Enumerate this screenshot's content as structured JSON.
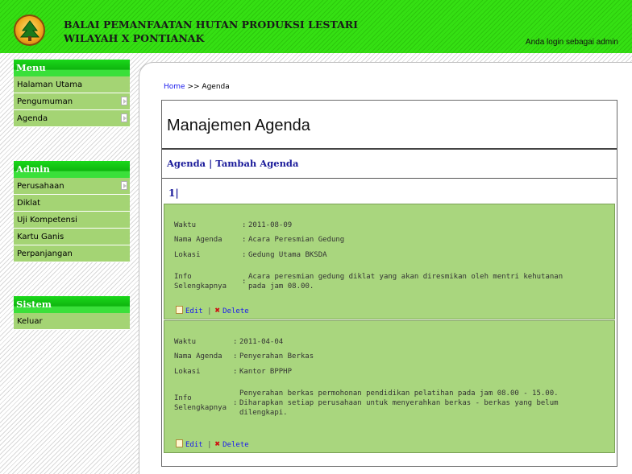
{
  "header": {
    "title_line1": "BALAI PEMANFAATAN HUTAN PRODUKSI LESTARI",
    "title_line2": "WILAYAH X PONTIANAK",
    "login_text": "Anda login sebagai admin",
    "logo_icon": "tree-logo-icon"
  },
  "sidebar": {
    "menu": {
      "title": "Menu",
      "items": [
        {
          "label": "Halaman Utama"
        },
        {
          "label": "Pengumuman"
        },
        {
          "label": "Agenda"
        }
      ]
    },
    "admin": {
      "title": "Admin",
      "items": [
        {
          "label": "Perusahaan"
        },
        {
          "label": "Diklat"
        },
        {
          "label": "Uji Kompetensi"
        },
        {
          "label": "Kartu Ganis"
        },
        {
          "label": "Perpanjangan"
        }
      ]
    },
    "sistem": {
      "title": "Sistem",
      "items": [
        {
          "label": "Keluar"
        }
      ]
    }
  },
  "main": {
    "breadcrumb": {
      "home": "Home",
      "separator": ">>",
      "current": "Agenda"
    },
    "page_title": "Manajemen Agenda",
    "subnav": {
      "agenda": "Agenda",
      "separator": "|",
      "tambah": "Tambah Agenda"
    },
    "pagination": {
      "page": "1",
      "separator": "|"
    },
    "labels": {
      "waktu": "Waktu",
      "nama": "Nama Agenda",
      "lokasi": "Lokasi",
      "info_line1": "Info",
      "info_line2": "Selengkapnya",
      "colon": ":",
      "edit": "Edit",
      "delete": "Delete",
      "action_sep": "|"
    },
    "agendas": [
      {
        "waktu": "2011-08-09",
        "nama": "Acara Peresmian Gedung",
        "lokasi": "Gedung Utama BKSDA",
        "info": [
          "Acara peresmian gedung diklat yang akan diresmikan oleh mentri kehutanan",
          "pada jam 08.00."
        ]
      },
      {
        "waktu": "2011-04-04",
        "nama": "Penyerahan Berkas",
        "lokasi": "Kantor BPPHP",
        "info": [
          "Penyerahan berkas permohonan pendidikan pelatihan pada jam 08.00 - 15.00.",
          "Diharapkan setiap perusahaan untuk menyerahkan berkas - berkas yang belum",
          "dilengkapi."
        ]
      }
    ]
  },
  "colors": {
    "header_green": "#33dd11",
    "menu_header_green": "#0eb40e",
    "menu_item_green": "#a4d474",
    "card_green": "#a9d67e",
    "link_blue": "#1a1aee"
  }
}
